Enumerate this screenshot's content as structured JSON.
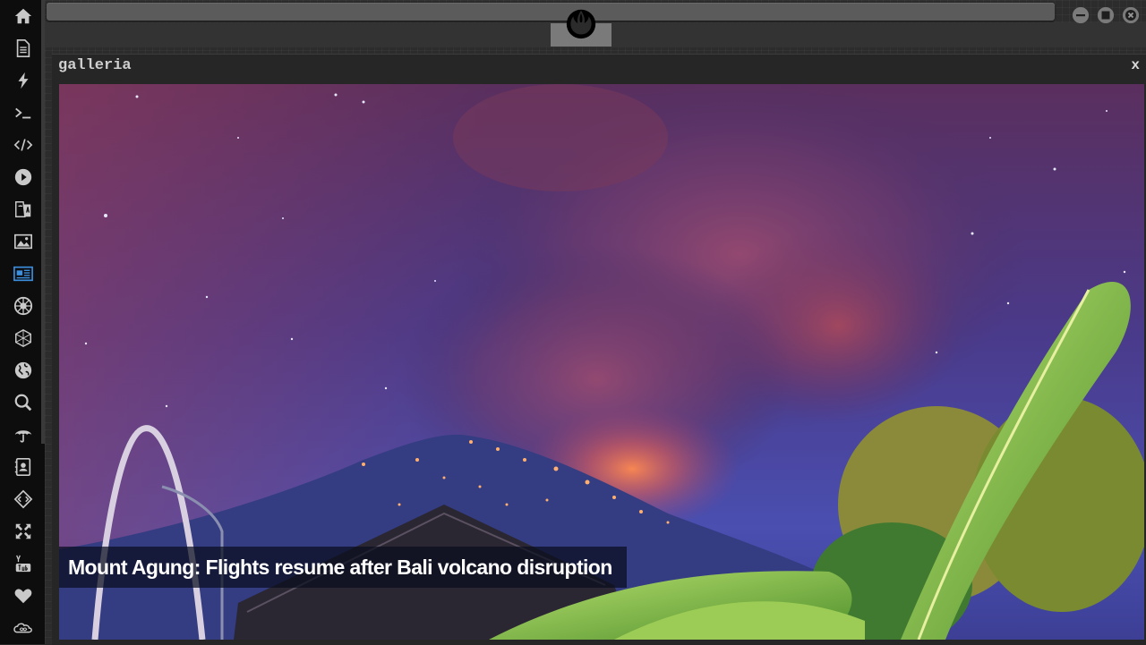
{
  "window": {
    "title": "galleria",
    "close_label": "x"
  },
  "gallery": {
    "caption": "Mount Agung: Flights resume after Bali volcano disruption"
  },
  "sidebar": {
    "items": [
      {
        "name": "home-icon"
      },
      {
        "name": "document-icon"
      },
      {
        "name": "lightning-icon"
      },
      {
        "name": "terminal-icon"
      },
      {
        "name": "code-icon"
      },
      {
        "name": "play-icon"
      },
      {
        "name": "translate-icon"
      },
      {
        "name": "image-icon"
      },
      {
        "name": "newspaper-icon",
        "active": true
      },
      {
        "name": "empire-icon"
      },
      {
        "name": "hexagon-network-icon"
      },
      {
        "name": "globe-icon"
      },
      {
        "name": "search-icon"
      },
      {
        "name": "umbrella-icon"
      },
      {
        "name": "contact-card-icon"
      },
      {
        "name": "developer-icon"
      },
      {
        "name": "fullscreen-icon"
      },
      {
        "name": "youtube-icon"
      },
      {
        "name": "heart-icon"
      },
      {
        "name": "infinity-cloud-icon"
      }
    ],
    "icon_color": "#c9c9c9",
    "active_color": "#3b8fe0"
  },
  "colors": {
    "background": "#2c2c2c",
    "sidebar": "#0d0d0d",
    "window": "#262626"
  }
}
